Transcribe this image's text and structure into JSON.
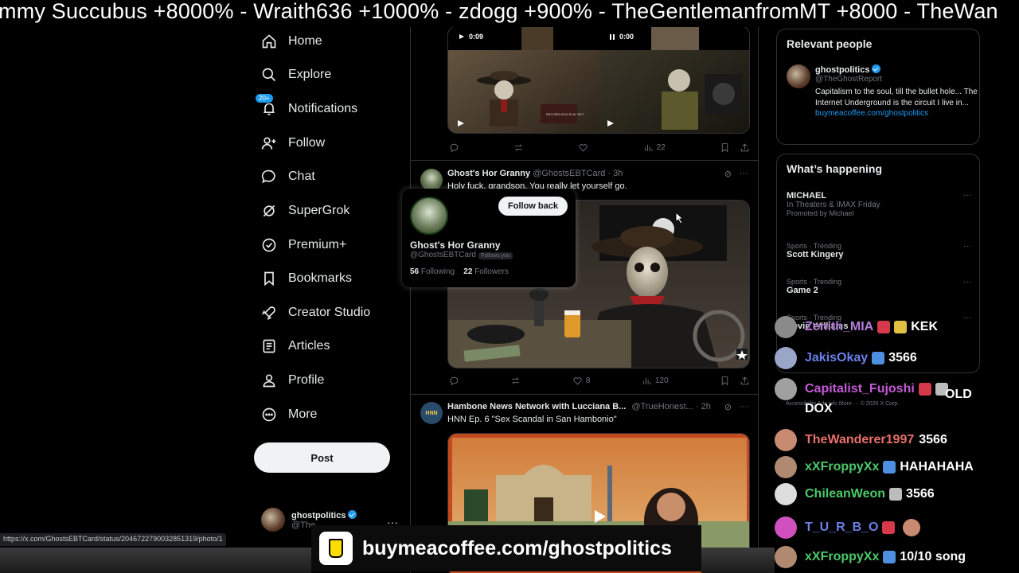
{
  "ticker": {
    "text": "mmy Succubus +8000% - Wraith636 +1000% - zdogg +900% - TheGentlemanfromMT +8000 - TheWan"
  },
  "sidebar": {
    "items": [
      {
        "label": "Home",
        "icon": "home-icon"
      },
      {
        "label": "Explore",
        "icon": "search-icon"
      },
      {
        "label": "Notifications",
        "icon": "bell-icon",
        "badge": "20+"
      },
      {
        "label": "Follow",
        "icon": "person-add-icon"
      },
      {
        "label": "Chat",
        "icon": "chat-icon"
      },
      {
        "label": "SuperGrok",
        "icon": "grok-icon"
      },
      {
        "label": "Premium+",
        "icon": "premium-icon"
      },
      {
        "label": "Bookmarks",
        "icon": "bookmark-icon"
      },
      {
        "label": "Creator Studio",
        "icon": "rocket-icon"
      },
      {
        "label": "Articles",
        "icon": "article-icon"
      },
      {
        "label": "Profile",
        "icon": "person-icon"
      },
      {
        "label": "More",
        "icon": "more-circle-icon"
      }
    ],
    "post_label": "Post",
    "account": {
      "name": "ghostpolitics",
      "handle": "@The",
      "more": "···"
    }
  },
  "feed": {
    "video1": {
      "time_left": "0:09",
      "time_right": "0:00",
      "sign": "RECORD DOG PLAY SET",
      "views": "22"
    },
    "tweet2": {
      "name": "Ghost's Hor Granny",
      "handle": "@GhostsEBTCard",
      "time": "· 3h",
      "text": "Holy fuck, grandson. You really let yourself go.",
      "likes": "8",
      "views": "120"
    },
    "tweet3": {
      "name": "Hambone News Network with Lucciana B...",
      "handle": "@TrueHonest...",
      "time": "· 2h",
      "text": "HNN Ep. 6 \"Sex Scandal in San Hambonio\"",
      "avatar_text": "HNN"
    }
  },
  "hovercard": {
    "follow_label": "Follow back",
    "name": "Ghost's Hor Granny",
    "handle": "@GhostsEBTCard",
    "follows_you": "Follows you",
    "following_count": "56",
    "following_label": "Following",
    "followers_count": "22",
    "followers_label": "Followers"
  },
  "right": {
    "relevant_title": "Relevant people",
    "person": {
      "name": "ghostpolitics",
      "handle": "@TheGhostReport",
      "bio": "Capitalism to the soul, till the bullet hole... The Internet Underground is the circuit I live in...",
      "link": "buymeacoffee.com/ghostpolitics"
    },
    "happening_title": "What’s happening",
    "trends": [
      {
        "meta": "",
        "name": "MICHAEL",
        "sub": "In Theaters & IMAX Friday",
        "promo": "Promoted by Michael"
      },
      {
        "meta": "Sports · Trending",
        "name": "Scott Kingery"
      },
      {
        "meta": "Sports · Trending",
        "name": "Game 2"
      },
      {
        "meta": "Sports · Trending",
        "name": "Devin Williams"
      }
    ],
    "footer": "Accessibility   Ads info   More ···   © 2026 X Corp."
  },
  "chat": [
    {
      "user": "Zenith_MIA",
      "color": "#b57edc",
      "text": "KEK",
      "av": "#8a8a8a",
      "b1": "#d63a4a",
      "b2": "#e0c040"
    },
    {
      "user": "JakisOkay",
      "color": "#6b7fe8",
      "text": "3566",
      "av": "#9aa6c8",
      "b1": "#4d8fe0"
    },
    {
      "user": "Capitalist_Fujoshi",
      "color": "#c45bd6",
      "text": "OLD DOX",
      "av": "#a0a0a0",
      "b1": "#d63a4a",
      "b2": "#bcbcbc"
    },
    {
      "user": "TheWanderer1997",
      "color": "#e8706a",
      "text": "3566",
      "av": "#c88a70"
    },
    {
      "user": "xXFroppyXx",
      "color": "#4bc96b",
      "text": "HAHAHAHA",
      "av": "#b08a70",
      "b1": "#4d8fe0"
    },
    {
      "user": "ChileanWeon",
      "color": "#4bc96b",
      "text": "3566",
      "av": "#dddddd",
      "b1": "#bcbcbc"
    },
    {
      "user": "T_U_R_B_O",
      "color": "#6b7fe8",
      "text": "",
      "av": "#d050c0",
      "b1": "#d63a4a"
    },
    {
      "user": "xXFroppyXx",
      "color": "#4bc96b",
      "text": "10/10 song",
      "av": "#b08a70",
      "b1": "#4d8fe0"
    }
  ],
  "status_url": "https://x.com/GhostsEBTCard/status/2046722790032851319/photo/1",
  "coffee_url": "buymeacoffee.com/ghostpolitics"
}
